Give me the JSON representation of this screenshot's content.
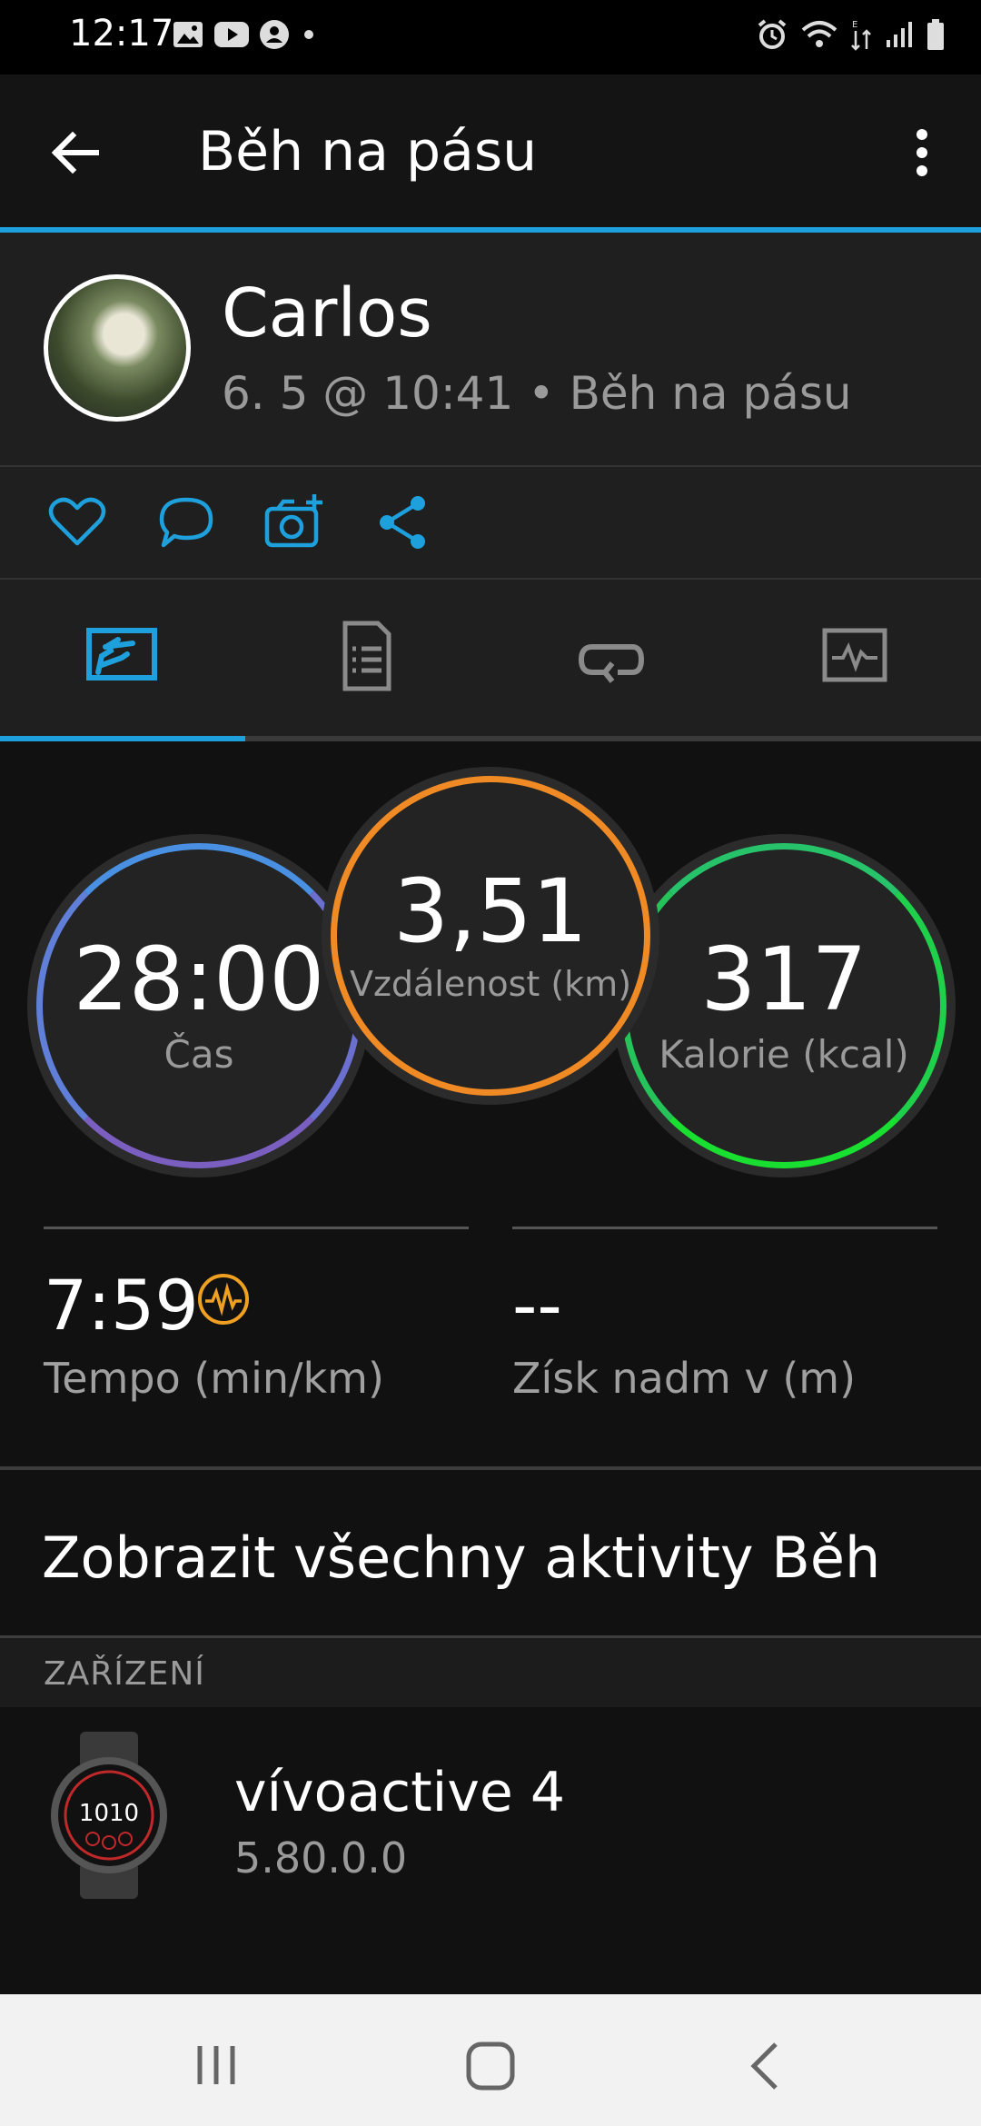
{
  "status_bar": {
    "time": "12:17"
  },
  "app_bar": {
    "title": "Běh na pásu"
  },
  "profile": {
    "name": "Carlos",
    "meta": "6. 5 @ 10:41 • Běh na pásu"
  },
  "tabs": [
    {
      "icon": "overview-chart-icon",
      "active": true
    },
    {
      "icon": "details-list-icon",
      "active": false
    },
    {
      "icon": "laps-icon",
      "active": false
    },
    {
      "icon": "activity-graph-icon",
      "active": false
    }
  ],
  "rings": {
    "time": {
      "value": "28:00",
      "label": "Čas"
    },
    "distance": {
      "value": "3,51",
      "label": "Vzdálenost (km)"
    },
    "calories": {
      "value": "317",
      "label": "Kalorie (kcal)"
    }
  },
  "stats": {
    "pace": {
      "value": "7:59",
      "label": "Tempo (min/km)"
    },
    "elevation": {
      "value": "--",
      "label": "Získ nadm v (m)"
    }
  },
  "all_activities_link": "Zobrazit všechny aktivity Běh",
  "devices_section": {
    "header": "ZAŘÍZENÍ",
    "device_name": "vívoactive 4",
    "device_version": "5.80.0.0",
    "watch_face_text": "1010"
  },
  "colors": {
    "accent_blue": "#1ea0dc",
    "distance_orange": "#f08a24",
    "calories_green": "#1fd14a",
    "time_purple": "#6b6fd0"
  }
}
